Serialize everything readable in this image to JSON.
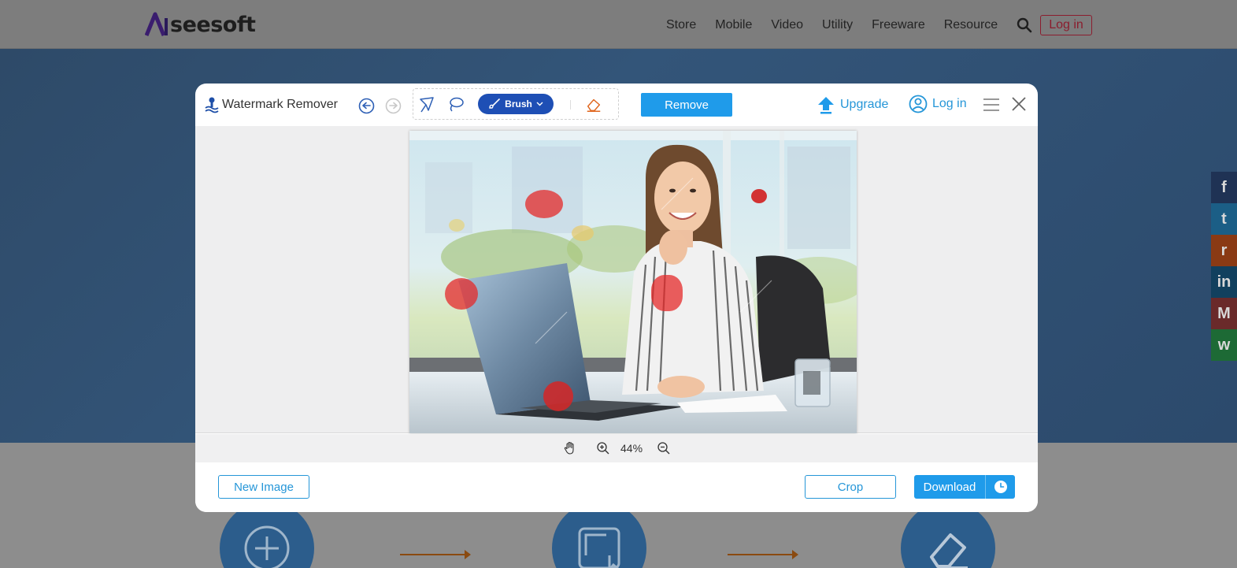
{
  "site": {
    "logo_text": "seesoft",
    "logo_letters": "AI",
    "nav": [
      "Store",
      "Mobile",
      "Video",
      "Utility",
      "Freeware",
      "Resource"
    ],
    "login_label": "Log in"
  },
  "share": [
    "f",
    "t",
    "r",
    "in",
    "M",
    "w"
  ],
  "app": {
    "title": "Watermark Remover",
    "brush_label": "Brush",
    "remove_label": "Remove",
    "upgrade_label": "Upgrade",
    "login_label": "Log in",
    "zoom": "44%",
    "new_image_label": "New Image",
    "crop_label": "Crop",
    "download_label": "Download"
  },
  "colors": {
    "accent": "#1f9bea",
    "brush_active": "#1e4fb5",
    "marker": "#e42a2a",
    "site_login": "#8b1d2e"
  }
}
